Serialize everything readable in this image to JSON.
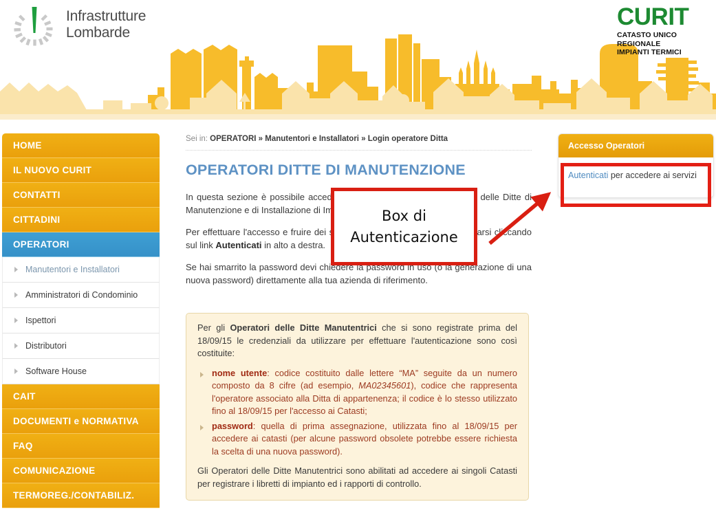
{
  "header": {
    "il_logo": {
      "icon": "infrastrutture-lombarde-sunburst-logo",
      "text": "Infrastrutture\nLombarde"
    },
    "curit_logo": {
      "word": "CURIT",
      "subtitle": "CATASTO UNICO\nREGIONALE\nIMPIANTI TERMICI",
      "color": "#1d8a32"
    },
    "banner_illustration": "milano-skyline-silhouette"
  },
  "sidebar": {
    "main_items": [
      {
        "label": "HOME",
        "active": false
      },
      {
        "label": "IL NUOVO CURIT",
        "active": false
      },
      {
        "label": "CONTATTI",
        "active": false
      },
      {
        "label": "CITTADINI",
        "active": false
      },
      {
        "label": "OPERATORI",
        "active": true
      }
    ],
    "sub_items": [
      {
        "label": "Manutentori e Installatori",
        "selected": true
      },
      {
        "label": "Amministratori di Condominio",
        "selected": false
      },
      {
        "label": "Ispettori",
        "selected": false
      },
      {
        "label": "Distributori",
        "selected": false
      },
      {
        "label": "Software House",
        "selected": false
      }
    ],
    "bottom_items": [
      {
        "label": "CAIT"
      },
      {
        "label": "DOCUMENTI e NORMATIVA"
      },
      {
        "label": "FAQ"
      },
      {
        "label": "COMUNICAZIONE"
      },
      {
        "label": "TERMOREG./CONTABILIZ."
      }
    ],
    "active_color": "#3e9fd4",
    "accent_color": "#f0b014"
  },
  "main": {
    "breadcrumb": {
      "label": "Sei in:",
      "path": "OPERATORI » Manutentori e Installatori » Login operatore Ditta"
    },
    "title": "OPERATORI DITTE DI MANUTENZIONE",
    "title_color": "#5e92c4",
    "paragraphs": [
      {
        "prefix": "In questa sezione è possibile accedere ai servizi dedicati agli Operatori delle Ditte di Manutenzione e di Installazione di Impianti Termici.",
        "bold": "",
        "suffix": ""
      },
      {
        "prefix": "Per effettuare l'accesso e fruire dei servizi dedicati è necessario autenticarsi cliccando sul link ",
        "bold": "Autenticati",
        "suffix": " in alto a destra."
      },
      {
        "prefix": "Se hai smarrito la password devi chiedere la password in uso (o la generazione di una nuova password) direttamente alla tua azienda di riferimento.",
        "bold": "",
        "suffix": ""
      }
    ]
  },
  "info_box": {
    "background": "#fdf3dc",
    "border_color": "#e8d7a8",
    "intro": {
      "prefix": "Per gli ",
      "bold": "Operatori delle Ditte Manutentrici",
      "suffix": " che si sono registrate prima del 18/09/15 le credenziali da utilizzare per effettuare l'autenticazione sono così costituite:"
    },
    "items": [
      {
        "bold": "nome utente",
        "text_before": ": codice costituito dalle lettere “MA” seguite da un numero composto da 8 cifre (ad esempio, ",
        "italic": "MA02345601",
        "text_after": "), codice che rappresenta l'operatore associato alla Ditta di appartenenza; il codice è lo stesso utilizzato fino al 18/09/15 per l'accesso ai Catasti;"
      },
      {
        "bold": "password",
        "text_before": ": quella di prima assegnazione, utilizzata fino al 18/09/15 per accedere ai catasti (per alcune password obsolete potrebbe essere richiesta la scelta di una nuova password).",
        "italic": "",
        "text_after": ""
      }
    ],
    "outro": "Gli Operatori delle Ditte Manutentrici sono abilitati ad accedere ai singoli Catasti per registrare i libretti di impianto ed i rapporti di controllo."
  },
  "right_panel": {
    "header": "Accesso Operatori",
    "link_text": "Autenticati",
    "body_text": " per accedere ai servizi",
    "link_color": "#4f8bc0"
  },
  "annotation": {
    "callout_line1": "Box di",
    "callout_line2": "Autenticazione",
    "callout_border_color": "#d91f12",
    "highlight_border_color": "#e31f14",
    "arrow": "red-arrow-pointing-to-authentication-box"
  }
}
